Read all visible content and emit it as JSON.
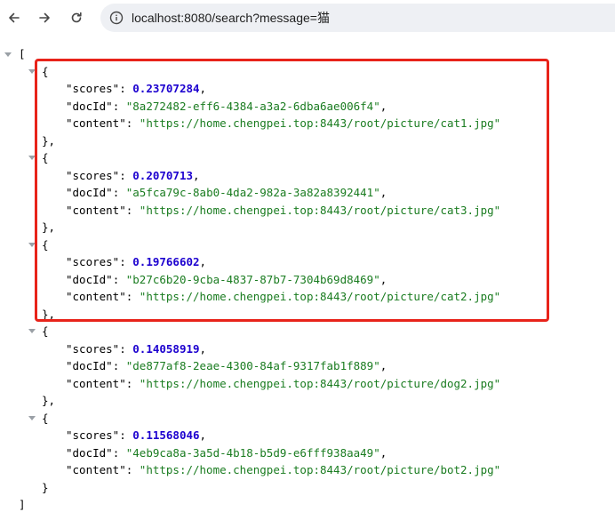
{
  "browser": {
    "url": "localhost:8080/search?message=猫"
  },
  "json_view": {
    "open_bracket": "[",
    "close_bracket": "]",
    "open_brace": "{",
    "close_brace_comma": "},",
    "close_brace": "}",
    "results": [
      {
        "scores": "0.23707284",
        "docId": "8a272482-eff6-4384-a3a2-6dba6ae006f4",
        "content": "https://home.chengpei.top:8443/root/picture/cat1.jpg"
      },
      {
        "scores": "0.2070713",
        "docId": "a5fca79c-8ab0-4da2-982a-3a82a8392441",
        "content": "https://home.chengpei.top:8443/root/picture/cat3.jpg"
      },
      {
        "scores": "0.19766602",
        "docId": "b27c6b20-9cba-4837-87b7-7304b69d8469",
        "content": "https://home.chengpei.top:8443/root/picture/cat2.jpg"
      },
      {
        "scores": "0.14058919",
        "docId": "de877af8-2eae-4300-84af-9317fab1f889",
        "content": "https://home.chengpei.top:8443/root/picture/dog2.jpg"
      },
      {
        "scores": "0.11568046",
        "docId": "4eb9ca8a-3a5d-4b18-b5d9-e6fff938aa49",
        "content": "https://home.chengpei.top:8443/root/picture/bot2.jpg"
      }
    ]
  },
  "colors": {
    "highlight_border": "#e8231a",
    "number": "#1c00cf",
    "string": "#1a7c20"
  }
}
